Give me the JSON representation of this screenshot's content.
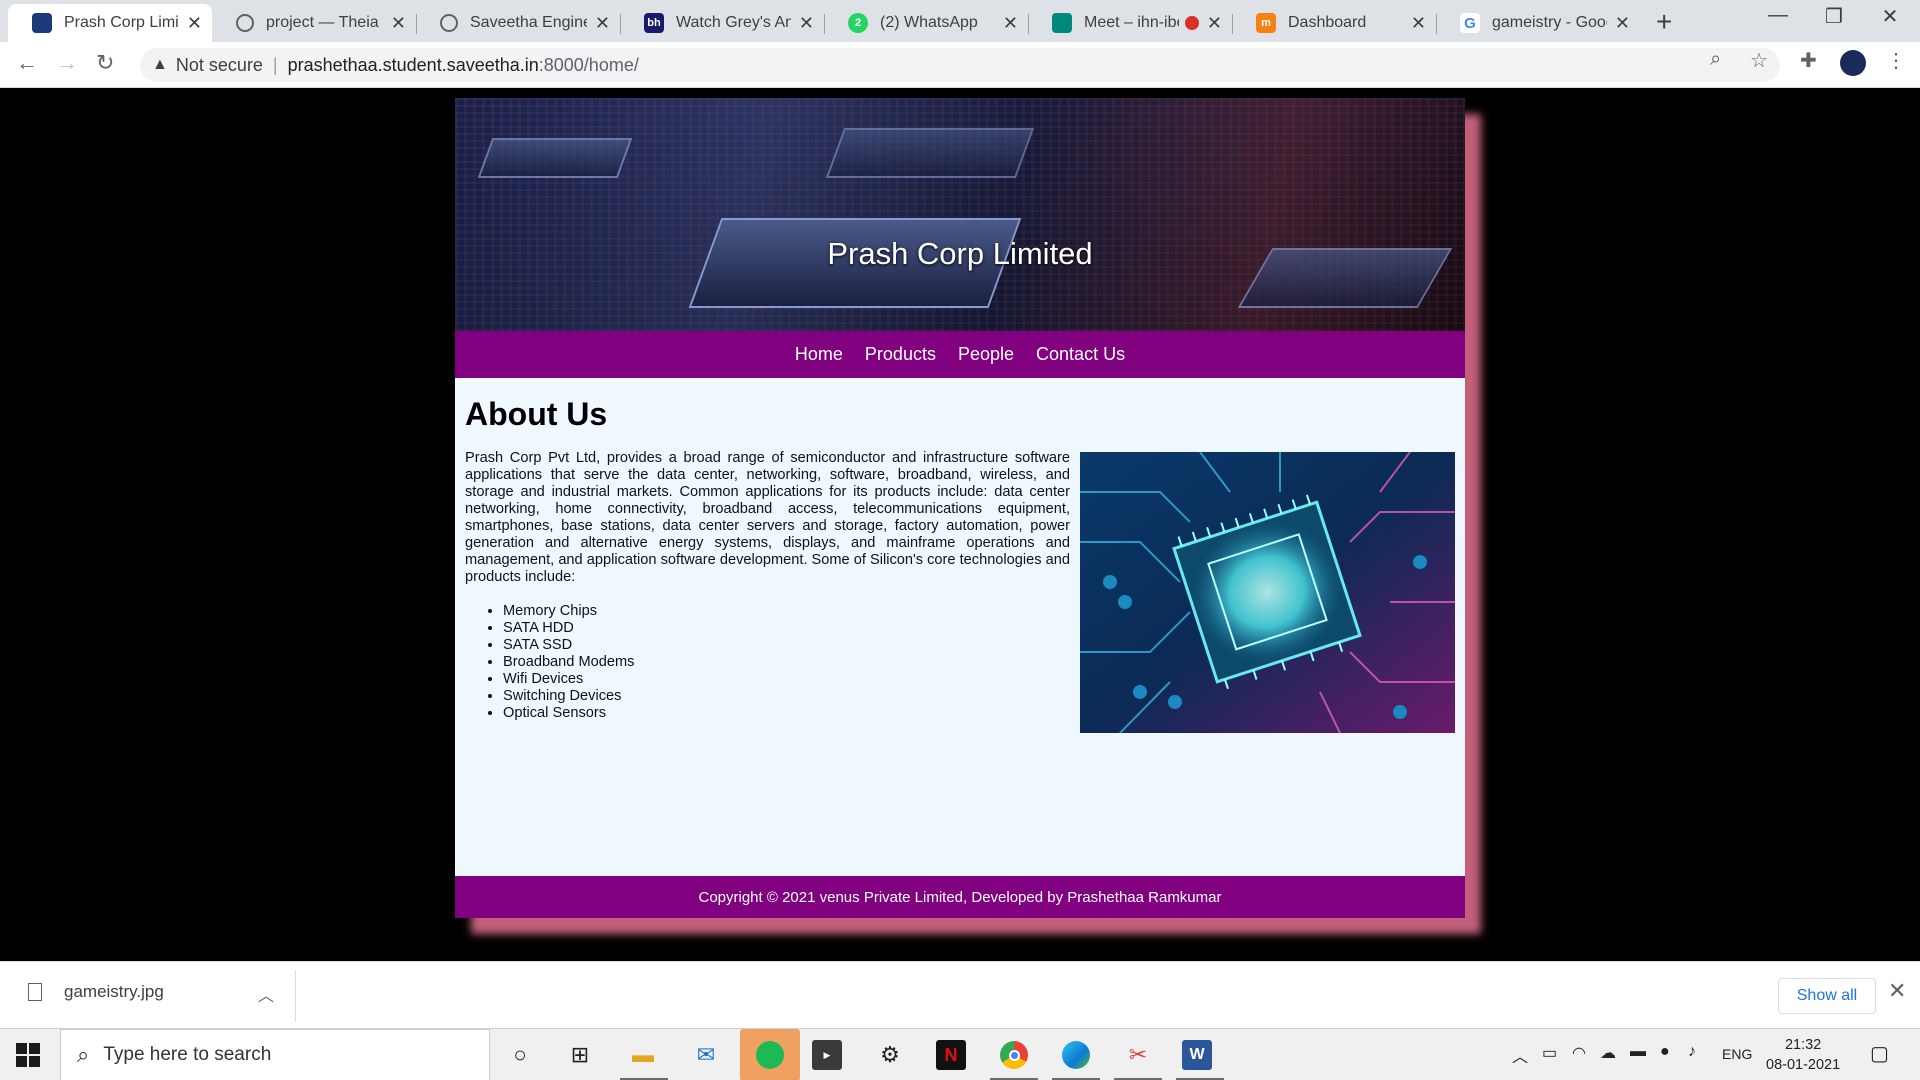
{
  "browser": {
    "tabs": [
      {
        "title": "Prash Corp Limited",
        "active": true,
        "favicon": "site-favicon",
        "color": "#1a3a7a"
      },
      {
        "title": "project — Theia M",
        "favicon": "globe-icon",
        "color": "#5f6368"
      },
      {
        "title": "Saveetha Engineer",
        "favicon": "globe-icon",
        "color": "#5f6368"
      },
      {
        "title": "Watch Grey's Anat",
        "favicon": "hbo-icon",
        "color": "#1a1a6a"
      },
      {
        "title": "(2) WhatsApp",
        "favicon": "whatsapp-icon",
        "color": "#25d366"
      },
      {
        "title": "Meet – ihn-ibe",
        "favicon": "meet-icon",
        "color": "#00897b"
      },
      {
        "title": "Dashboard",
        "favicon": "moodle-icon",
        "color": "#f98012"
      },
      {
        "title": "gameistry - Googl",
        "favicon": "google-icon",
        "color": "#4285f4"
      }
    ],
    "new_tab_label": "+",
    "address": {
      "security_label": "Not secure",
      "url_host": "prashethaa.student.saveetha.in",
      "url_rest": ":8000/home/"
    }
  },
  "site": {
    "title": "Prash Corp Limited",
    "nav": [
      "Home",
      "Products",
      "People",
      "Contact Us"
    ],
    "heading": "About Us",
    "about": "Prash Corp Pvt Ltd, provides a broad range of semiconductor and infrastructure software applications that serve the data center, networking, software, broadband, wireless, and storage and industrial markets. Common applications for its products include: data center networking, home connectivity, broadband access, telecommunications equipment, smartphones, base stations, data center servers and storage, factory automation, power generation and alternative energy systems, displays, and mainframe operations and management, and application software development. Some of Silicon's core technologies and products include:",
    "products": [
      "Memory Chips",
      "SATA HDD",
      "SATA SSD",
      "Broadband Modems",
      "Wifi Devices",
      "Switching Devices",
      "Optical Sensors"
    ],
    "footer": "Copyright © 2021 venus Private Limited, Developed by Prashethaa Ramkumar",
    "colors": {
      "nav_bg": "#800080",
      "content_bg": "#f0f8ff",
      "shadow": "#c2607a"
    }
  },
  "downloads": {
    "file": "gameistry.jpg",
    "show_all": "Show all"
  },
  "taskbar": {
    "search_placeholder": "Type here to search",
    "language": "ENG",
    "time": "21:32",
    "date": "08-01-2021"
  }
}
